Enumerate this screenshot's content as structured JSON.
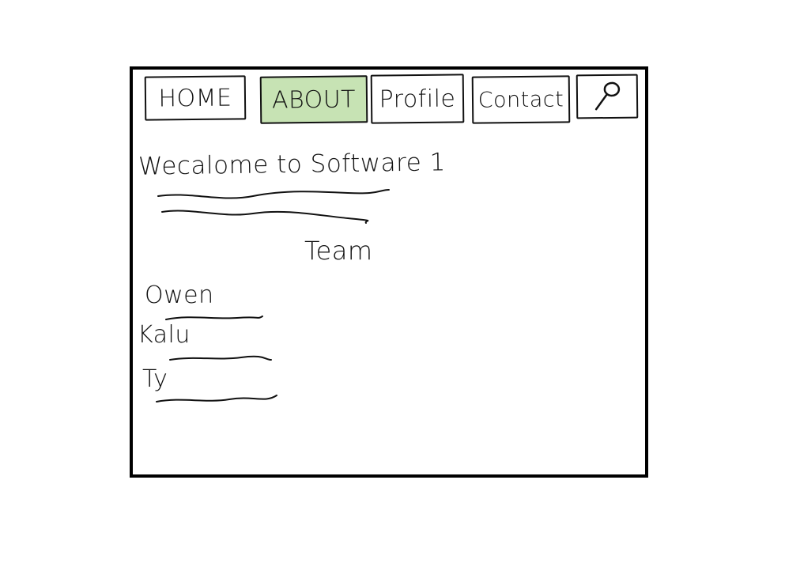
{
  "nav": {
    "tabs": [
      {
        "label": "HOME"
      },
      {
        "label": "ABOUT",
        "active": true
      },
      {
        "label": "Profile"
      },
      {
        "label": "Contact"
      }
    ],
    "search_icon": "search-icon",
    "active_color": "#c7e3b4"
  },
  "content": {
    "welcome": "Wecalome to Software 1",
    "team_heading": "Team",
    "members": [
      "Owen",
      "Kalu",
      "Ty"
    ]
  }
}
